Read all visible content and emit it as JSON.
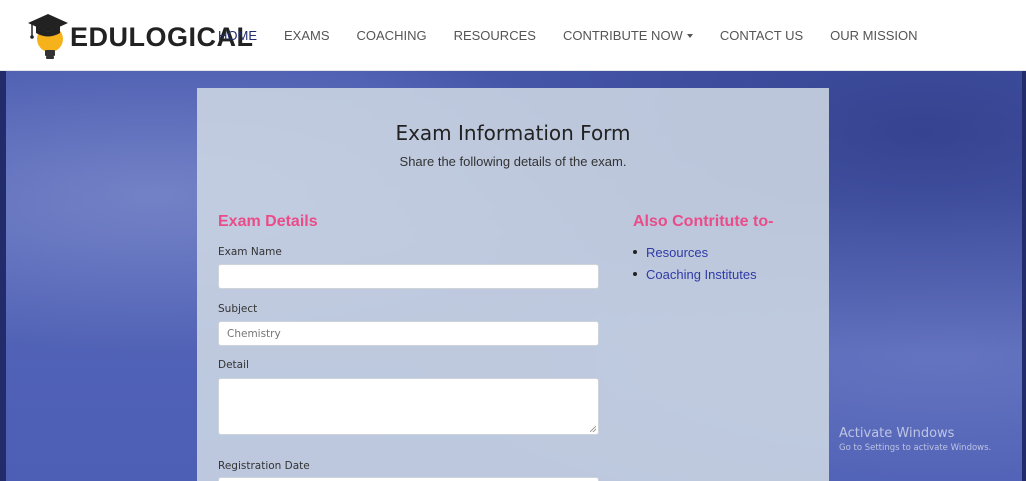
{
  "brand": {
    "name": "EDULOGICAL",
    "logo_icon": "graduation-cap-bulb-icon"
  },
  "nav": {
    "items": [
      {
        "label": "HOME",
        "active": true
      },
      {
        "label": "EXAMS"
      },
      {
        "label": "COACHING"
      },
      {
        "label": "RESOURCES"
      },
      {
        "label": "CONTRIBUTE NOW",
        "dropdown": true
      },
      {
        "label": "CONTACT US"
      },
      {
        "label": "OUR MISSION"
      }
    ]
  },
  "form": {
    "title": "Exam Information Form",
    "subtitle": "Share the following details of the exam.",
    "section_heading": "Exam Details",
    "fields": {
      "exam_name": {
        "label": "Exam Name",
        "value": ""
      },
      "subject": {
        "label": "Subject",
        "placeholder": "Chemistry"
      },
      "detail": {
        "label": "Detail",
        "value": ""
      },
      "registration_date": {
        "label": "Registration Date"
      }
    }
  },
  "aside": {
    "heading": "Also Contritute to-",
    "links": [
      "Resources",
      "Coaching Institutes"
    ]
  },
  "watermark": {
    "title": "Activate Windows",
    "subtitle": "Go to Settings to activate Windows."
  },
  "colors": {
    "accent_pink": "#ea4c89",
    "link_blue": "#2f3aa6",
    "nav_active": "#222c6a",
    "background_blue": "#4d5fb5"
  }
}
